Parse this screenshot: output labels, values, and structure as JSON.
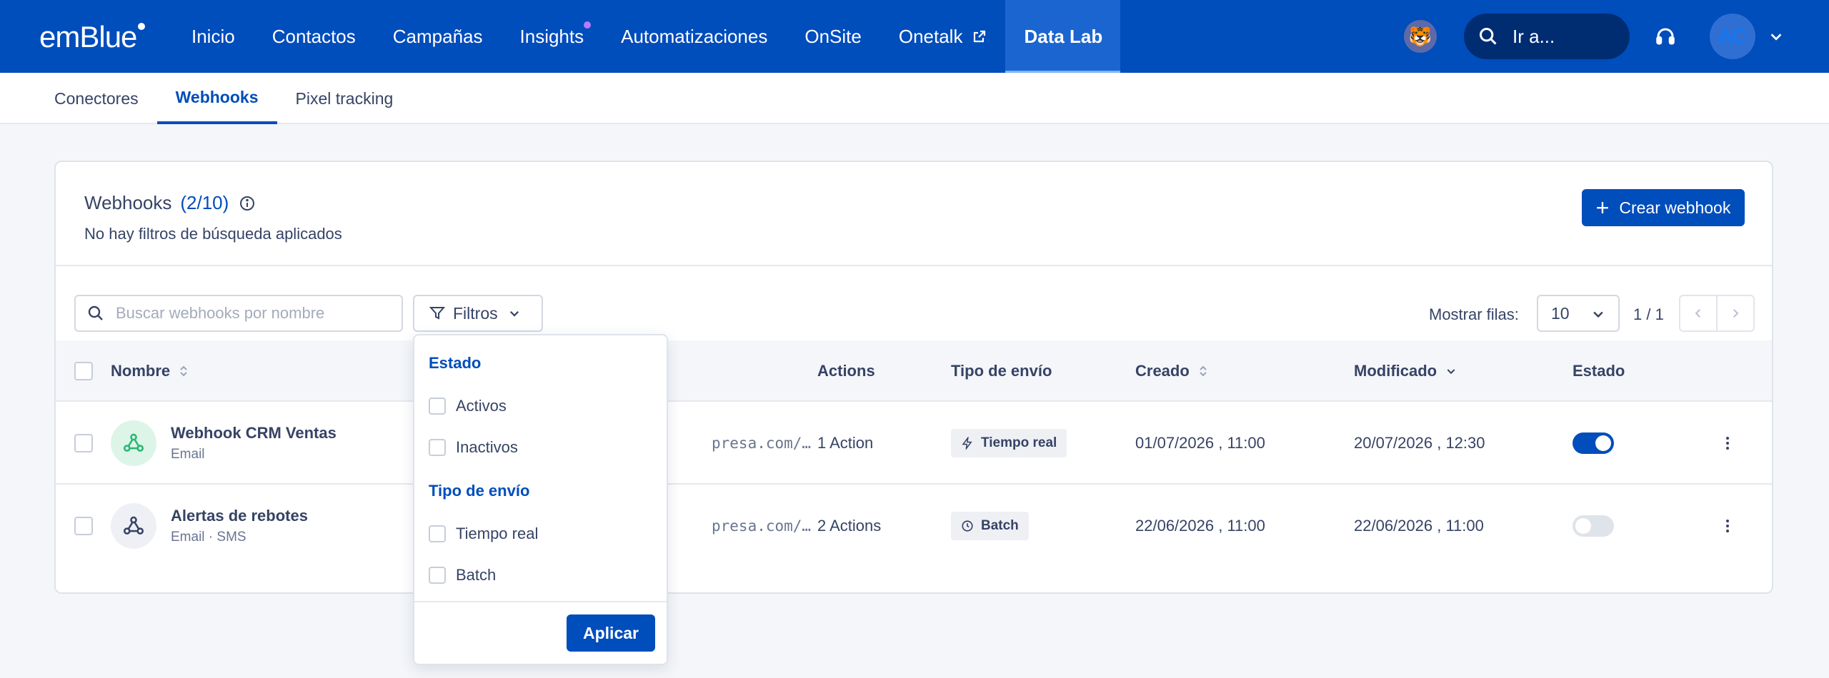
{
  "brand": {
    "logo_text": "emBlue",
    "primary_color": "#004dbc",
    "notification_color": "#b57cff"
  },
  "nav": {
    "items": [
      {
        "label": "Inicio"
      },
      {
        "label": "Contactos"
      },
      {
        "label": "Campañas"
      },
      {
        "label": "Insights"
      },
      {
        "label": "Automatizaciones"
      },
      {
        "label": "OnSite"
      },
      {
        "label": "Onetalk"
      },
      {
        "label": "Data Lab"
      }
    ],
    "active": "Data Lab",
    "search_label": "Ir a...",
    "user_initials": "AC"
  },
  "subtabs": {
    "items": [
      {
        "label": "Conectores"
      },
      {
        "label": "Webhooks"
      },
      {
        "label": "Pixel tracking"
      }
    ],
    "active": "Webhooks"
  },
  "card": {
    "title": "Webhooks",
    "count": "(2/10)",
    "subtitle": "No hay filtros de búsqueda aplicados",
    "create_button": "Crear webhook"
  },
  "toolbar": {
    "search_placeholder": "Buscar webhooks por nombre",
    "filter_label": "Filtros",
    "rows_label": "Mostrar filas:",
    "rows_value": "10",
    "page_info": "1 / 1"
  },
  "table": {
    "columns": {
      "name": "Nombre",
      "actions": "Actions",
      "send_type": "Tipo de envío",
      "created": "Creado",
      "modified": "Modificado",
      "status": "Estado"
    },
    "rows": [
      {
        "name": "Webhook CRM Ventas",
        "channels": "Email",
        "url": "presa.com/…",
        "actions": "1 Action",
        "send_type": "Tiempo real",
        "created": "01/07/2026 , 11:00",
        "modified": "20/07/2026 , 12:30",
        "enabled": true
      },
      {
        "name": "Alertas de rebotes",
        "channels": "Email · SMS",
        "url": "presa.com/…",
        "actions": "2 Actions",
        "send_type": "Batch",
        "created": "22/06/2026 , 11:00",
        "modified": "22/06/2026 , 11:00",
        "enabled": false
      }
    ]
  },
  "filters_dropdown": {
    "section_status": "Estado",
    "status_options": [
      {
        "label": "Activos",
        "checked": false
      },
      {
        "label": "Inactivos",
        "checked": false
      }
    ],
    "section_send_type": "Tipo de envío",
    "send_type_options": [
      {
        "label": "Tiempo real",
        "checked": false
      },
      {
        "label": "Batch",
        "checked": false
      }
    ],
    "apply_label": "Aplicar"
  }
}
